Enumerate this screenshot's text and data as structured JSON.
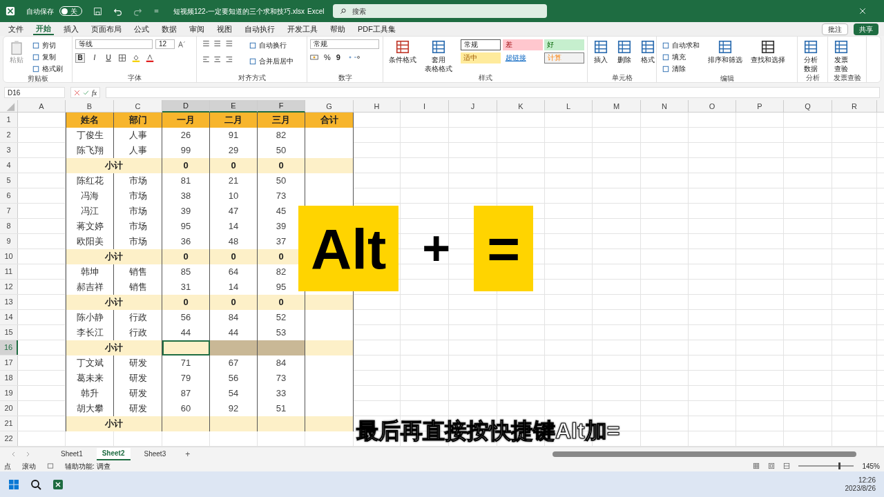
{
  "title_bar": {
    "autosave_label": "自动保存",
    "autosave": {
      "on": false,
      "label": "关"
    },
    "filename": "短视频122-一定要知道的三个求和技巧.xlsx",
    "app": "Excel",
    "search": {
      "placeholder": "搜索"
    }
  },
  "menu_tabs": [
    {
      "label": "文件",
      "selected": false
    },
    {
      "label": "开始",
      "selected": true
    },
    {
      "label": "插入",
      "selected": false
    },
    {
      "label": "页面布局",
      "selected": false
    },
    {
      "label": "公式",
      "selected": false
    },
    {
      "label": "数据",
      "selected": false
    },
    {
      "label": "审阅",
      "selected": false
    },
    {
      "label": "视图",
      "selected": false
    },
    {
      "label": "自动执行",
      "selected": false
    },
    {
      "label": "开发工具",
      "selected": false
    },
    {
      "label": "帮助",
      "selected": false
    },
    {
      "label": "PDF工具集",
      "selected": false
    }
  ],
  "comment_button": "批注",
  "share_button": "共享",
  "ribbon": {
    "clipboard": {
      "label": "剪贴板",
      "paste": "粘贴",
      "cut": "剪切",
      "copy": "复制",
      "format_painter": "格式刷"
    },
    "font": {
      "label": "字体",
      "font_name": "等线",
      "font_size": "12",
      "bold": "B",
      "italic": "I",
      "underline": "U"
    },
    "alignment": {
      "label": "对齐方式",
      "wrap": "自动换行",
      "merge": "合并后居中"
    },
    "number": {
      "label": "数字",
      "format": "常规",
      "percent": "%",
      "comma": "9"
    },
    "styles": {
      "label": "样式",
      "conditional": "条件格式",
      "table_format": [
        "套用",
        "表格格式"
      ],
      "cell_styles": [
        {
          "label": "常规",
          "kind": "normal"
        },
        {
          "label": "差",
          "kind": "bad"
        },
        {
          "label": "好",
          "kind": "good"
        },
        {
          "label": "适中",
          "kind": "neutral"
        },
        {
          "label": "超链接",
          "kind": "link"
        },
        {
          "label": "计算",
          "kind": "calc"
        }
      ]
    },
    "cells": {
      "label": "单元格",
      "buttons": [
        "插入",
        "删除",
        "格式"
      ]
    },
    "editing": {
      "label": "编辑",
      "autosum": "自动求和",
      "fill": "填充",
      "clear": "清除",
      "sort": "排序和筛选",
      "find": "查找和选择"
    },
    "analysis": {
      "label": "分析",
      "button": [
        "分析",
        "数据"
      ]
    },
    "invoice": {
      "label": "发票查验",
      "button": [
        "发票",
        "查验"
      ]
    }
  },
  "formula_bar": {
    "name_box": "D16",
    "fx": "fx"
  },
  "columns": [
    {
      "label": "A",
      "selected": false
    },
    {
      "label": "B",
      "selected": false
    },
    {
      "label": "C",
      "selected": false
    },
    {
      "label": "D",
      "selected": true
    },
    {
      "label": "E",
      "selected": true
    },
    {
      "label": "F",
      "selected": true
    },
    {
      "label": "G",
      "selected": false
    },
    {
      "label": "H",
      "selected": false
    },
    {
      "label": "I",
      "selected": false
    },
    {
      "label": "J",
      "selected": false
    },
    {
      "label": "K",
      "selected": false
    },
    {
      "label": "L",
      "selected": false
    },
    {
      "label": "M",
      "selected": false
    },
    {
      "label": "N",
      "selected": false
    },
    {
      "label": "O",
      "selected": false
    },
    {
      "label": "P",
      "selected": false
    },
    {
      "label": "Q",
      "selected": false
    },
    {
      "label": "R",
      "selected": false
    }
  ],
  "rows": [
    {
      "number": "1",
      "kind": "header",
      "selected": false,
      "cells": [
        "姓名",
        "部门",
        "一月",
        "二月",
        "三月",
        "合计"
      ]
    },
    {
      "number": "2",
      "kind": "data",
      "selected": false,
      "cells": [
        "丁俊生",
        "人事",
        "26",
        "91",
        "82",
        null
      ]
    },
    {
      "number": "3",
      "kind": "data",
      "selected": false,
      "cells": [
        "陈飞翔",
        "人事",
        "99",
        "29",
        "50",
        null
      ]
    },
    {
      "number": "4",
      "kind": "subtotal",
      "selected": false,
      "cells": [
        "小计",
        "0",
        "0",
        "0",
        null
      ]
    },
    {
      "number": "5",
      "kind": "data",
      "selected": false,
      "cells": [
        "陈红花",
        "市场",
        "81",
        "21",
        "50",
        null
      ]
    },
    {
      "number": "6",
      "kind": "data",
      "selected": false,
      "cells": [
        "冯海",
        "市场",
        "38",
        "10",
        "73",
        null
      ]
    },
    {
      "number": "7",
      "kind": "data",
      "selected": false,
      "cells": [
        "冯江",
        "市场",
        "39",
        "47",
        "45",
        null
      ]
    },
    {
      "number": "8",
      "kind": "data",
      "selected": false,
      "cells": [
        "蒋文婷",
        "市场",
        "95",
        "14",
        "39",
        null
      ]
    },
    {
      "number": "9",
      "kind": "data",
      "selected": false,
      "cells": [
        "欧阳美",
        "市场",
        "36",
        "48",
        "37",
        null
      ]
    },
    {
      "number": "10",
      "kind": "subtotal",
      "selected": false,
      "cells": [
        "小计",
        "0",
        "0",
        "0",
        null
      ]
    },
    {
      "number": "11",
      "kind": "data",
      "selected": false,
      "cells": [
        "韩坤",
        "销售",
        "85",
        "64",
        "82",
        null
      ]
    },
    {
      "number": "12",
      "kind": "data",
      "selected": false,
      "cells": [
        "郝吉祥",
        "销售",
        "31",
        "14",
        "95",
        null
      ]
    },
    {
      "number": "13",
      "kind": "subtotal",
      "selected": false,
      "cells": [
        "小计",
        "0",
        "0",
        "0",
        null
      ]
    },
    {
      "number": "14",
      "kind": "data",
      "selected": false,
      "cells": [
        "陈小静",
        "行政",
        "56",
        "84",
        "52",
        null
      ]
    },
    {
      "number": "15",
      "kind": "data",
      "selected": false,
      "cells": [
        "李长江",
        "行政",
        "44",
        "44",
        "53",
        null
      ]
    },
    {
      "number": "16",
      "kind": "subtotal",
      "selected": true,
      "cells": [
        "小计",
        null,
        null,
        null,
        null
      ]
    },
    {
      "number": "17",
      "kind": "data",
      "selected": false,
      "cells": [
        "丁文斌",
        "研发",
        "71",
        "67",
        "84",
        null
      ]
    },
    {
      "number": "18",
      "kind": "data",
      "selected": false,
      "cells": [
        "葛未来",
        "研发",
        "79",
        "56",
        "73",
        null
      ]
    },
    {
      "number": "19",
      "kind": "data",
      "selected": false,
      "cells": [
        "韩升",
        "研发",
        "87",
        "54",
        "33",
        null
      ]
    },
    {
      "number": "20",
      "kind": "data",
      "selected": false,
      "cells": [
        "胡大攀",
        "研发",
        "60",
        "92",
        "51",
        null
      ]
    },
    {
      "number": "21",
      "kind": "subtotal",
      "selected": false,
      "cells": [
        "小计",
        null,
        null,
        null,
        null
      ]
    },
    {
      "number": "22",
      "kind": "empty",
      "selected": false,
      "cells": []
    }
  ],
  "overlay": {
    "keys": [
      {
        "label": "Alt",
        "kind": "key"
      },
      {
        "label": "+",
        "kind": "plus"
      },
      {
        "label": "=",
        "kind": "key"
      }
    ],
    "subtitle": "最后再直接按快捷键Alt加="
  },
  "sheet_tabs": [
    {
      "label": "Sheet1",
      "selected": false
    },
    {
      "label": "Sheet2",
      "selected": true
    },
    {
      "label": "Sheet3",
      "selected": false
    }
  ],
  "add_sheet": "+",
  "status_bar": {
    "mode": "点",
    "scroll": "滚动",
    "accessibility": "辅助功能: 调查",
    "zoom": {
      "level": 0.72,
      "reading": "145%"
    }
  },
  "taskbar": {
    "time": "12:26",
    "date": "2023/8/26"
  }
}
